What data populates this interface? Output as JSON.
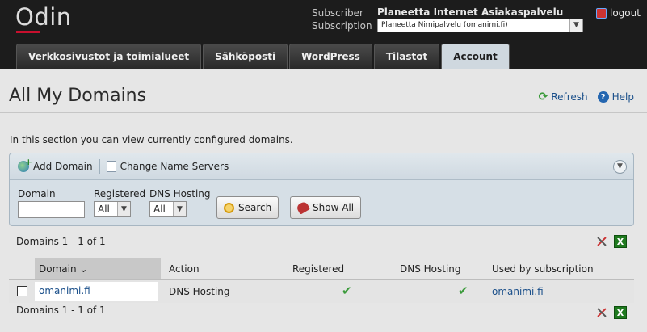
{
  "header": {
    "logo": "Odin",
    "subscriber_label": "Subscriber",
    "subscriber_value": "Planeetta Internet Asiakaspalvelu",
    "subscription_label": "Subscription",
    "subscription_value": "Planeetta Nimipalvelu (omanimi.fi)",
    "logout": "logout"
  },
  "tabs": [
    {
      "label": "Verkkosivustot ja toimialueet"
    },
    {
      "label": "Sähköposti"
    },
    {
      "label": "WordPress"
    },
    {
      "label": "Tilastot"
    },
    {
      "label": "Account",
      "active": true
    }
  ],
  "page": {
    "title": "All My Domains",
    "refresh": "Refresh",
    "help": "Help",
    "intro": "In this section you can view currently configured domains."
  },
  "toolbar": {
    "add_domain": "Add Domain",
    "change_ns": "Change Name Servers"
  },
  "filters": {
    "domain_label": "Domain",
    "domain_value": "",
    "registered_label": "Registered",
    "registered_value": "All",
    "dns_label": "DNS Hosting",
    "dns_value": "All",
    "search": "Search",
    "show_all": "Show All"
  },
  "grid": {
    "count_top": "Domains 1 - 1 of 1",
    "count_bottom": "Domains 1 - 1 of 1",
    "columns": {
      "domain": "Domain",
      "action": "Action",
      "registered": "Registered",
      "dns": "DNS Hosting",
      "used_by": "Used by subscription"
    },
    "rows": [
      {
        "domain": "omanimi.fi",
        "action": "DNS Hosting",
        "registered": true,
        "dns_hosting": true,
        "used_by": "omanimi.fi"
      }
    ]
  },
  "colors": {
    "header_bg": "#1c1c1c",
    "logo_accent": "#c8102e",
    "link": "#1a4f8a",
    "check": "#3a9a3a"
  }
}
